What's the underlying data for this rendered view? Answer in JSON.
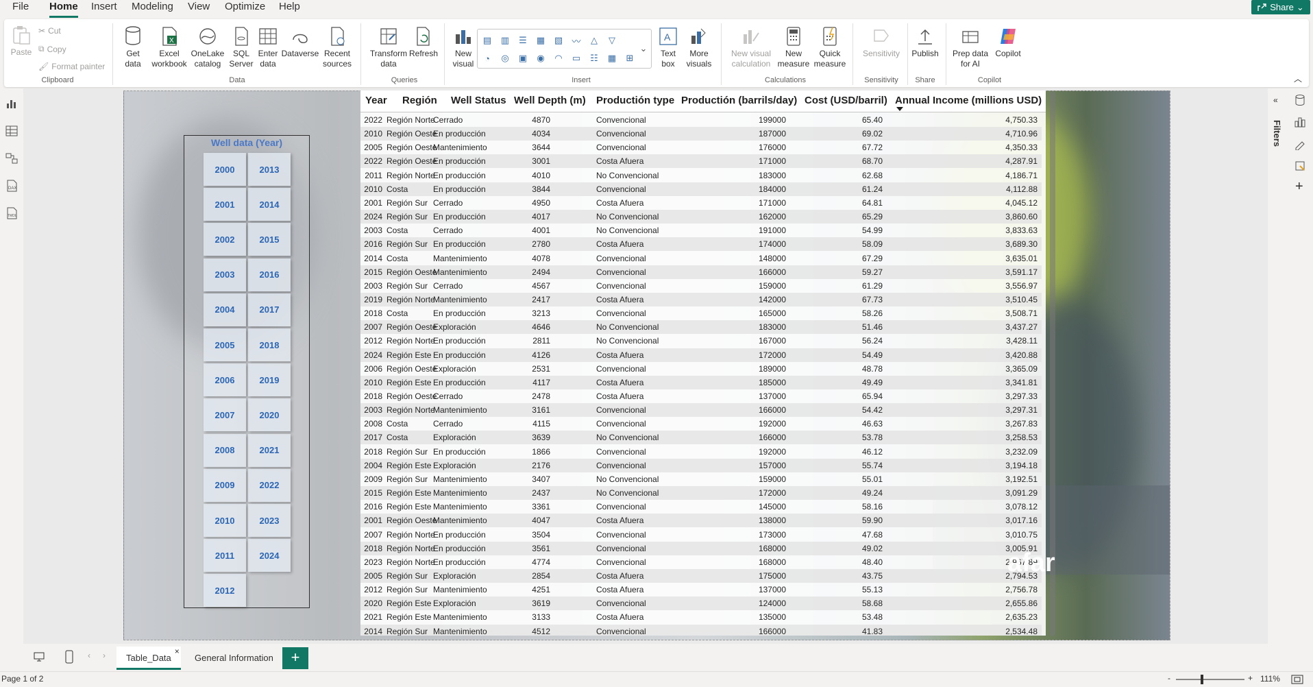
{
  "menu": {
    "file": "File",
    "home": "Home",
    "insert": "Insert",
    "modeling": "Modeling",
    "view": "View",
    "optimize": "Optimize",
    "help": "Help",
    "share": "Share"
  },
  "ribbon": {
    "paste": "Paste",
    "cut": "Cut",
    "copy": "Copy",
    "format_painter": "Format painter",
    "clipboard": "Clipboard",
    "get_data": "Get data",
    "excel": "Excel workbook",
    "onelake": "OneLake catalog",
    "sql": "SQL Server",
    "enter_data": "Enter data",
    "dataverse": "Dataverse",
    "recent": "Recent sources",
    "data_group": "Data",
    "transform": "Transform data",
    "refresh": "Refresh",
    "queries": "Queries",
    "new_visual": "New visual",
    "text_box": "Text box",
    "more_visuals": "More visuals",
    "insert_group": "Insert",
    "new_visual_calc": "New visual calculation",
    "new_measure": "New measure",
    "quick_measure": "Quick measure",
    "calculations": "Calculations",
    "sensitivity_btn": "Sensitivity",
    "sensitivity_group": "Sensitivity",
    "publish": "Publish",
    "share_group": "Share",
    "prep_ai": "Prep data for AI",
    "copilot_btn": "Copilot",
    "copilot_group": "Copilot"
  },
  "filters_label": "Filters",
  "slicer": {
    "title": "Well data (Year)",
    "years": [
      "2000",
      "2001",
      "2002",
      "2003",
      "2004",
      "2005",
      "2006",
      "2007",
      "2008",
      "2009",
      "2010",
      "2011",
      "2012",
      "2013",
      "2014",
      "2015",
      "2016",
      "2017",
      "2018",
      "2019",
      "2020",
      "2021",
      "2022",
      "2023",
      "2024"
    ]
  },
  "table": {
    "columns": [
      "Year",
      "Región",
      "Well Status",
      "Well Depth (m)",
      "Productión type",
      "Productión (barrils/day)",
      "Cost (USD/barril)",
      "Annual Income (millions USD)"
    ],
    "rows": [
      [
        "2022",
        "Región Norte",
        "Cerrado",
        "4870",
        "Convencional",
        "199000",
        "65.40",
        "4,750.33"
      ],
      [
        "2010",
        "Región Oeste",
        "En producción",
        "4034",
        "Convencional",
        "187000",
        "69.02",
        "4,710.96"
      ],
      [
        "2005",
        "Región Oeste",
        "Mantenimiento",
        "3644",
        "Convencional",
        "176000",
        "67.72",
        "4,350.33"
      ],
      [
        "2022",
        "Región Oeste",
        "En producción",
        "3001",
        "Costa Afuera",
        "171000",
        "68.70",
        "4,287.91"
      ],
      [
        "2011",
        "Región Norte",
        "En producción",
        "4010",
        "No Convencional",
        "183000",
        "62.68",
        "4,186.71"
      ],
      [
        "2010",
        "Costa",
        "En producción",
        "3844",
        "Convencional",
        "184000",
        "61.24",
        "4,112.88"
      ],
      [
        "2001",
        "Región Sur",
        "Cerrado",
        "4950",
        "Costa Afuera",
        "171000",
        "64.81",
        "4,045.12"
      ],
      [
        "2024",
        "Región Sur",
        "En producción",
        "4017",
        "No Convencional",
        "162000",
        "65.29",
        "3,860.60"
      ],
      [
        "2003",
        "Costa",
        "Cerrado",
        "4001",
        "No Convencional",
        "191000",
        "54.99",
        "3,833.63"
      ],
      [
        "2016",
        "Región Sur",
        "En producción",
        "2780",
        "Costa Afuera",
        "174000",
        "58.09",
        "3,689.30"
      ],
      [
        "2014",
        "Costa",
        "Mantenimiento",
        "4078",
        "Convencional",
        "148000",
        "67.29",
        "3,635.01"
      ],
      [
        "2015",
        "Región Oeste",
        "Mantenimiento",
        "2494",
        "Convencional",
        "166000",
        "59.27",
        "3,591.17"
      ],
      [
        "2003",
        "Región Sur",
        "Cerrado",
        "4567",
        "Convencional",
        "159000",
        "61.29",
        "3,556.97"
      ],
      [
        "2019",
        "Región Norte",
        "Mantenimiento",
        "2417",
        "Costa Afuera",
        "142000",
        "67.73",
        "3,510.45"
      ],
      [
        "2018",
        "Costa",
        "En producción",
        "3213",
        "Convencional",
        "165000",
        "58.26",
        "3,508.71"
      ],
      [
        "2007",
        "Región Oeste",
        "Exploración",
        "4646",
        "No Convencional",
        "183000",
        "51.46",
        "3,437.27"
      ],
      [
        "2012",
        "Región Norte",
        "En producción",
        "2811",
        "No Convencional",
        "167000",
        "56.24",
        "3,428.11"
      ],
      [
        "2024",
        "Región Este",
        "En producción",
        "4126",
        "Costa Afuera",
        "172000",
        "54.49",
        "3,420.88"
      ],
      [
        "2006",
        "Región Oeste",
        "Exploración",
        "2531",
        "Convencional",
        "189000",
        "48.78",
        "3,365.09"
      ],
      [
        "2010",
        "Región Este",
        "En producción",
        "4117",
        "Costa Afuera",
        "185000",
        "49.49",
        "3,341.81"
      ],
      [
        "2018",
        "Región Oeste",
        "Cerrado",
        "2478",
        "Costa Afuera",
        "137000",
        "65.94",
        "3,297.33"
      ],
      [
        "2003",
        "Región Norte",
        "Mantenimiento",
        "3161",
        "Convencional",
        "166000",
        "54.42",
        "3,297.31"
      ],
      [
        "2008",
        "Costa",
        "Cerrado",
        "4115",
        "Convencional",
        "192000",
        "46.63",
        "3,267.83"
      ],
      [
        "2017",
        "Costa",
        "Exploración",
        "3639",
        "No Convencional",
        "166000",
        "53.78",
        "3,258.53"
      ],
      [
        "2018",
        "Región Sur",
        "En producción",
        "1866",
        "Convencional",
        "192000",
        "46.12",
        "3,232.09"
      ],
      [
        "2004",
        "Región Este",
        "Exploración",
        "2176",
        "Convencional",
        "157000",
        "55.74",
        "3,194.18"
      ],
      [
        "2009",
        "Región Sur",
        "Mantenimiento",
        "3407",
        "No Convencional",
        "159000",
        "55.01",
        "3,192.51"
      ],
      [
        "2015",
        "Región Este",
        "Mantenimiento",
        "2437",
        "No Convencional",
        "172000",
        "49.24",
        "3,091.29"
      ],
      [
        "2016",
        "Región Este",
        "Mantenimiento",
        "3361",
        "Convencional",
        "145000",
        "58.16",
        "3,078.12"
      ],
      [
        "2001",
        "Región Oeste",
        "Mantenimiento",
        "4047",
        "Costa Afuera",
        "138000",
        "59.90",
        "3,017.16"
      ],
      [
        "2007",
        "Región Norte",
        "En producción",
        "3504",
        "Convencional",
        "173000",
        "47.68",
        "3,010.75"
      ],
      [
        "2018",
        "Región Norte",
        "En producción",
        "3561",
        "Convencional",
        "168000",
        "49.02",
        "3,005.91"
      ],
      [
        "2023",
        "Región Norte",
        "En producción",
        "4774",
        "Convencional",
        "168000",
        "48.40",
        "2,967.89"
      ],
      [
        "2005",
        "Región Sur",
        "Exploración",
        "2854",
        "Costa Afuera",
        "175000",
        "43.75",
        "2,794.53"
      ],
      [
        "2012",
        "Región Sur",
        "Mantenimiento",
        "4251",
        "Costa Afuera",
        "137000",
        "55.13",
        "2,756.78"
      ],
      [
        "2020",
        "Región Este",
        "Exploración",
        "3619",
        "Convencional",
        "124000",
        "58.68",
        "2,655.86"
      ],
      [
        "2021",
        "Región Este",
        "Mantenimiento",
        "3133",
        "Costa Afuera",
        "135000",
        "53.48",
        "2,635.23"
      ],
      [
        "2014",
        "Región Sur",
        "Mantenimiento",
        "4512",
        "Convencional",
        "166000",
        "41.83",
        "2,534.48"
      ]
    ]
  },
  "brand_text": "afar",
  "pages": {
    "tab1": "Table_Data",
    "tab2": "General Information",
    "close": "×",
    "add": "+"
  },
  "status": {
    "page": "Page 1 of 2",
    "zoom": "111%",
    "minus": "-",
    "plus": "+"
  }
}
